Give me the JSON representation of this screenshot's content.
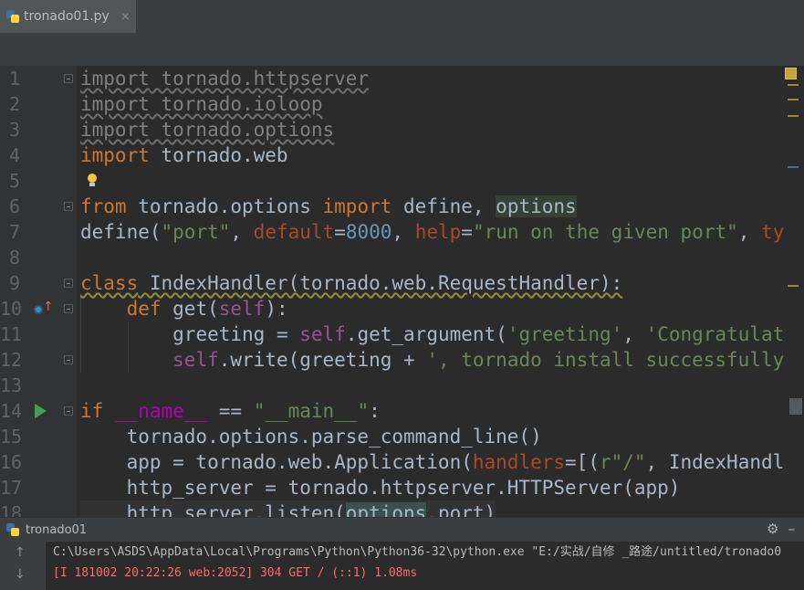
{
  "tab": {
    "title": "tronado01.py",
    "icon": "python-file-icon"
  },
  "editor": {
    "line_numbers": [
      "1",
      "2",
      "3",
      "4",
      "5",
      "6",
      "7",
      "8",
      "9",
      "10",
      "11",
      "12",
      "13",
      "14",
      "15",
      "16",
      "17",
      "18"
    ],
    "lines": {
      "l1": {
        "kw": "import",
        "rest": " tornado.httpserver"
      },
      "l2": {
        "kw": "import",
        "rest": " tornado.ioloop"
      },
      "l3": {
        "kw": "import",
        "rest": " tornado.options"
      },
      "l4": {
        "kw": "import",
        "rest": " tornado.web"
      },
      "l6": {
        "kw1": "from",
        "mid": " tornado.options ",
        "kw2": "import",
        "rest": " define, ",
        "sel": "options"
      },
      "l7": {
        "a": "define(",
        "s1": "\"port\"",
        "b": ", ",
        "k1": "default",
        "c": "=",
        "n1": "8000",
        "d": ", ",
        "k2": "help",
        "e": "=",
        "s2": "\"run on the given port\"",
        "f": ", ",
        "k3": "ty"
      },
      "l9": {
        "kw": "class",
        "name": " IndexHandler",
        "rest": "(tornado.web.RequestHandler):"
      },
      "l10": {
        "indent": "    ",
        "kw": "def",
        "name": " get(",
        "self": "self",
        "rest": "):"
      },
      "l11": {
        "indent": "        ",
        "a": "greeting = ",
        "self": "self",
        "b": ".get_argument(",
        "s1": "'greeting'",
        "c": ", ",
        "s2": "'Congratulat"
      },
      "l12": {
        "indent": "        ",
        "self": "self",
        "a": ".write(greeting + ",
        "s1": "', tornado install successfully"
      },
      "l14": {
        "kw": "if",
        "sp": " ",
        "d": "__name__",
        "a": " == ",
        "s": "\"__main__\"",
        "b": ":"
      },
      "l15": {
        "text": "    tornado.options.parse_command_line()"
      },
      "l16": {
        "a": "    app = tornado.web.Application(",
        "k": "handlers",
        "b": "=[(",
        "s": "r\"/\"",
        "c": ", IndexHandl"
      },
      "l17": {
        "text": "    http_server = tornado.httpserver.HTTPServer(app)"
      },
      "l18": {
        "a": "    http_server.listen(",
        "h": "options",
        "b": ".port)"
      }
    }
  },
  "run_panel": {
    "title": "tronado01",
    "settings_icon": "⚙",
    "hide_icon": "–",
    "command": "C:\\Users\\ASDS\\AppData\\Local\\Programs\\Python\\Python36-32\\python.exe \"E:/实战/自修 _路途/untitled/tronado0",
    "log": "[I 181002 20:22:26 web:2052] 304 GET / (::1) 1.08ms",
    "up_icon": "↑",
    "down_icon": "↓"
  },
  "colors": {
    "keyword": "#cc7832",
    "string": "#6a8759",
    "number": "#6897bb",
    "self": "#94558d",
    "error": "#ff6b68"
  }
}
